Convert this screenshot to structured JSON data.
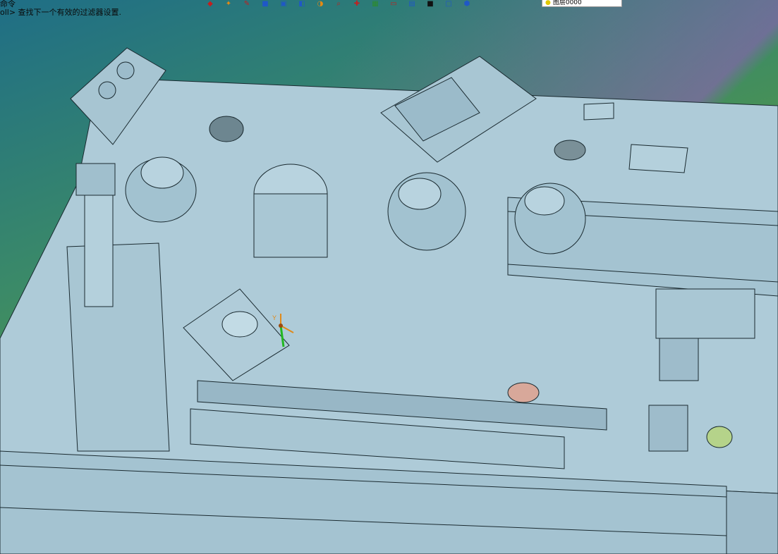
{
  "cmd": {
    "line1": "命令",
    "line2": "oll> 查找下一个有效的过滤器设置."
  },
  "toolbar": {
    "buttons": [
      {
        "icon": "sketch-icon",
        "glyph": "◆",
        "tone": "red"
      },
      {
        "icon": "shape-icon",
        "glyph": "✦",
        "tone": "orange"
      },
      {
        "icon": "pencil-icon",
        "glyph": "✎",
        "tone": "red"
      },
      {
        "icon": "cube-icon",
        "glyph": "■",
        "tone": "blue"
      },
      {
        "icon": "box-icon",
        "glyph": "▣",
        "tone": "blue"
      },
      {
        "icon": "view-icon",
        "glyph": "◧",
        "tone": "blue"
      },
      {
        "icon": "render-icon",
        "glyph": "◑",
        "tone": "orange"
      },
      {
        "icon": "zoom-icon",
        "glyph": "⌕",
        "tone": "red"
      },
      {
        "icon": "snap-icon",
        "glyph": "✚",
        "tone": "red"
      },
      {
        "icon": "grid-icon",
        "glyph": "▦",
        "tone": "green"
      },
      {
        "icon": "layer-props-icon",
        "glyph": "▭",
        "tone": "red"
      },
      {
        "icon": "print-icon",
        "glyph": "▤",
        "tone": "blue"
      },
      {
        "icon": "color-icon",
        "glyph": "■",
        "tone": "dark"
      },
      {
        "icon": "linetype-icon",
        "glyph": "□",
        "tone": "blue"
      },
      {
        "icon": "material-icon",
        "glyph": "⬢",
        "tone": "blue"
      }
    ]
  },
  "layer": {
    "name": "图层0000"
  },
  "colors": {
    "model_fill": "#aecbd8",
    "model_line": "#1a2a30"
  }
}
